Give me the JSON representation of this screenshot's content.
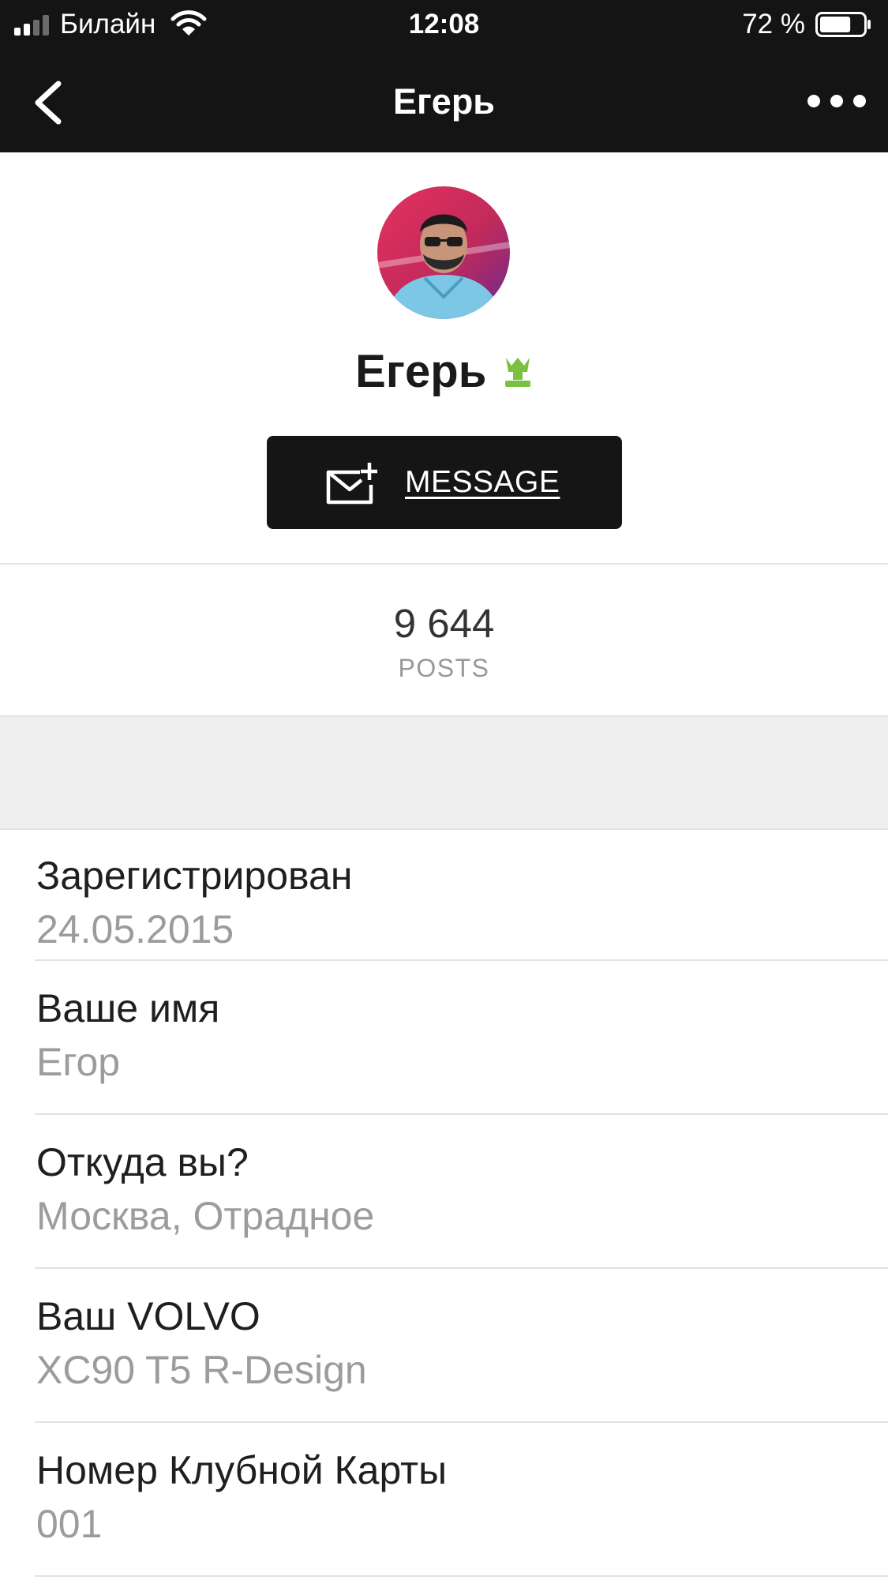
{
  "status_bar": {
    "carrier": "Билайн",
    "time": "12:08",
    "battery": "72 %",
    "battery_level": 0.72,
    "icons": [
      "signal-icon",
      "wifi-icon",
      "battery-icon"
    ]
  },
  "nav": {
    "title": "Егерь",
    "back_icon": "chevron-left-icon",
    "more_icon": "more-dots-icon"
  },
  "profile": {
    "name": "Егерь",
    "rank_icon": "crown-rank-icon",
    "rank_color": "#7ac142",
    "message_label": "MESSAGE",
    "message_icon": "compose-mail-icon"
  },
  "stats": {
    "posts_value": "9 644",
    "posts_label": "POSTS"
  },
  "fields": [
    {
      "label": "Зарегистрирован",
      "value": "24.05.2015"
    },
    {
      "label": "Ваше имя",
      "value": "Егор"
    },
    {
      "label": "Откуда вы?",
      "value": "Москва, Отрадное"
    },
    {
      "label": "Ваш VOLVO",
      "value": "XC90 T5 R-Design"
    },
    {
      "label": "Номер Клубной Карты",
      "value": "001"
    }
  ],
  "colors": {
    "bar_background": "#141414",
    "button_background": "#151515",
    "label_text": "#1f1f1f",
    "value_text": "#9c9c9c",
    "section_band": "#efefef"
  }
}
